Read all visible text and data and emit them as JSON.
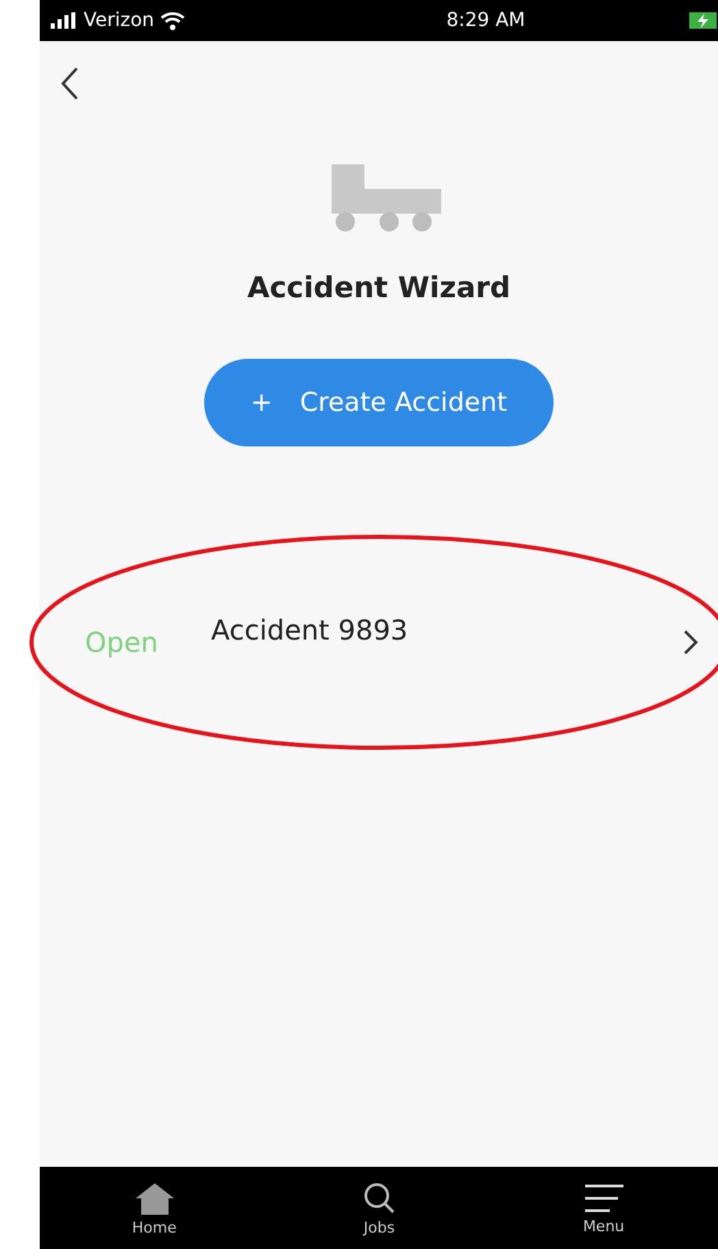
{
  "status_bar": {
    "carrier": "Verizon",
    "time": "8:29 AM",
    "charging": true
  },
  "header": {
    "title": "Accident Wizard"
  },
  "create_button": {
    "icon": "+",
    "label": "Create Accident"
  },
  "accidents": [
    {
      "status": "Open",
      "color": "#7fd27f",
      "title": "Accident 9893"
    }
  ],
  "annotation": {
    "kind": "ellipse",
    "color": "#e8141b"
  },
  "tab_bar": [
    {
      "kind": "home",
      "label": "Home"
    },
    {
      "kind": "search",
      "label": "Jobs"
    },
    {
      "kind": "menu",
      "label": "Menu"
    }
  ]
}
